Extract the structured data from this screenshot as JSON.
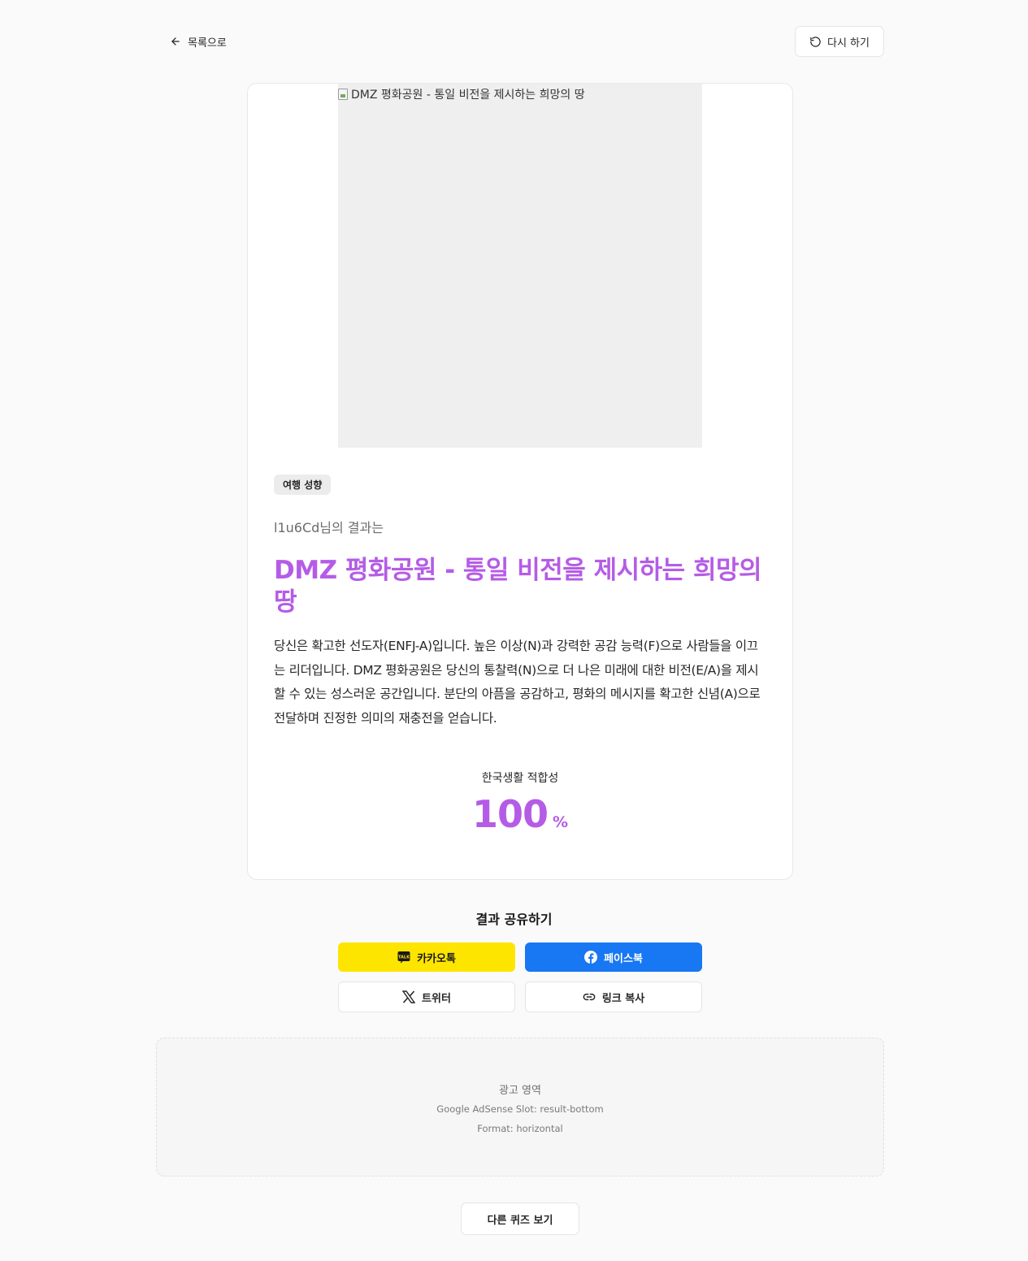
{
  "nav": {
    "back_label": "목록으로",
    "retry_label": "다시 하기"
  },
  "result": {
    "image_alt": "DMZ 평화공원 - 통일 비전을 제시하는 희망의 땅",
    "category": "여행 성향",
    "intro": "l1u6Cd님의 결과는",
    "title": "DMZ 평화공원 - 통일 비전을 제시하는 희망의 땅",
    "description": "당신은 확고한 선도자(ENFJ-A)입니다. 높은 이상(N)과 강력한 공감 능력(F)으로 사람들을 이끄는 리더입니다. DMZ 평화공원은 당신의 통찰력(N)으로 더 나은 미래에 대한 비전(E/A)을 제시할 수 있는 성스러운 공간입니다. 분단의 아픔을 공감하고, 평화의 메시지를 확고한 신념(A)으로 전달하며 진정한 의미의 재충전을 얻습니다.",
    "fit_label": "한국생활 적합성",
    "fit_value": "100",
    "fit_unit": "%"
  },
  "share": {
    "title": "결과 공유하기",
    "kakao_label": "카카오톡",
    "facebook_label": "페이스북",
    "twitter_label": "트위터",
    "link_label": "링크 복사"
  },
  "ad": {
    "title": "광고 영역",
    "slot": "Google AdSense Slot: result-bottom",
    "format": "Format: horizontal"
  },
  "more_quiz_label": "다른 퀴즈 보기",
  "colors": {
    "accent": "#b55ce6",
    "kakao": "#fee500",
    "facebook": "#1877f2",
    "background": "#fafafa"
  },
  "icons": {
    "back": "arrow-left-icon",
    "retry": "rotate-ccw-icon",
    "kakao": "kakao-talk-icon",
    "facebook": "facebook-icon",
    "twitter": "x-logo-icon",
    "link": "link-icon"
  }
}
